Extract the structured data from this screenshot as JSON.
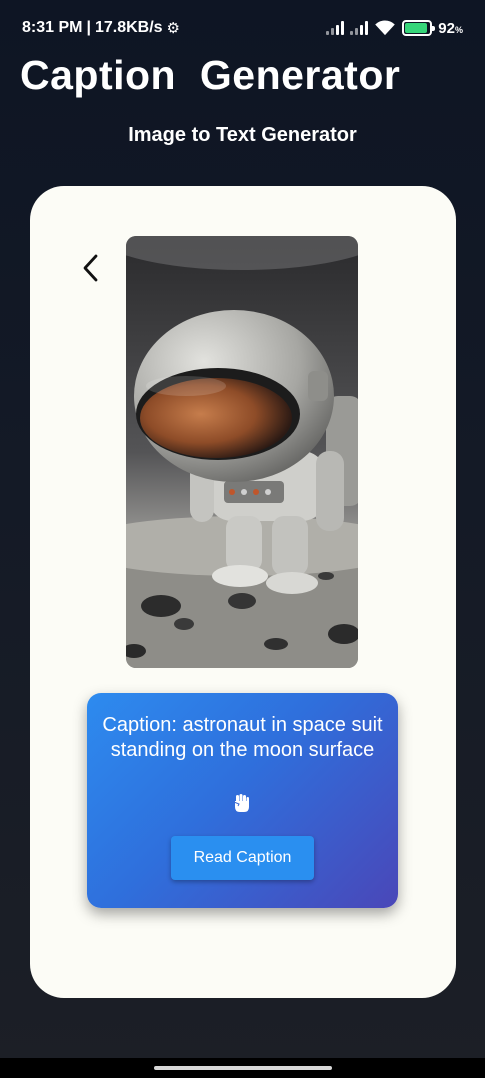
{
  "status_bar": {
    "time": "8:31 PM",
    "separator": "|",
    "network_speed": "17.8KB/s",
    "settings_icon": "gear-icon",
    "battery_percent": "92",
    "battery_unit": "%",
    "battery_level": 0.92,
    "battery_color": "#37d67a"
  },
  "header": {
    "app_title": "Caption  Generator",
    "subtitle": "Image to Text Generator"
  },
  "card": {
    "back_icon": "chevron-left-icon",
    "image_icon": "astronaut-image"
  },
  "caption": {
    "text": "Caption: astronaut in space suit standing on the moon surface",
    "icon": "raised-fist-icon",
    "button_label": "Read Caption"
  },
  "colors": {
    "background": "#111827",
    "card": "#fcfcf6",
    "caption_gradient_start": "#2d8bef",
    "caption_gradient_end": "#4a47b8",
    "button": "#2a8ff0"
  }
}
